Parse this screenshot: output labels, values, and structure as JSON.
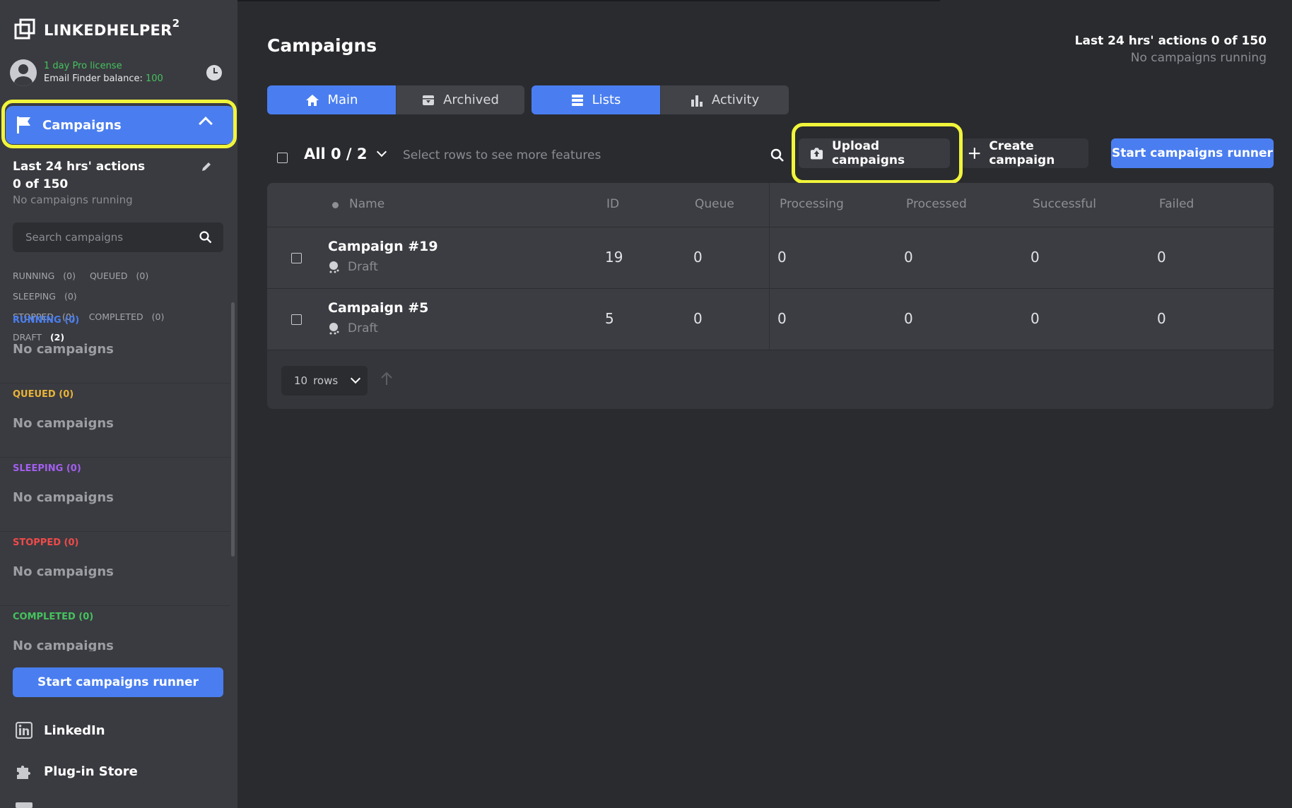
{
  "app": {
    "brand": "LINKEDHELPER",
    "brand_sup": "2",
    "license": "1 day Pro license",
    "email_balance_label": "Email Finder balance:",
    "email_balance_value": "100"
  },
  "sidebar": {
    "campaigns_label": "Campaigns",
    "actions_line1": "Last 24 hrs' actions",
    "actions_line2": "0 of 150",
    "running_text": "No campaigns running",
    "search_placeholder": "Search campaigns",
    "filters": [
      {
        "label": "RUNNING",
        "count": "(0)"
      },
      {
        "label": "QUEUED",
        "count": "(0)"
      },
      {
        "label": "SLEEPING",
        "count": "(0)"
      },
      {
        "label": "STOPPED",
        "count": "(0)"
      },
      {
        "label": "COMPLETED",
        "count": "(0)"
      },
      {
        "label": "DRAFT",
        "count": "(2)"
      }
    ],
    "groups": [
      {
        "label": "RUNNING",
        "count": "(0)",
        "color": "#4a7ef0",
        "empty": "No campaigns"
      },
      {
        "label": "QUEUED",
        "count": "(0)",
        "color": "#e8b339",
        "empty": "No campaigns"
      },
      {
        "label": "SLEEPING",
        "count": "(0)",
        "color": "#a35ff0",
        "empty": "No campaigns"
      },
      {
        "label": "STOPPED",
        "count": "(0)",
        "color": "#ef4a4a",
        "empty": "No campaigns"
      },
      {
        "label": "COMPLETED",
        "count": "(0)",
        "color": "#45c25f",
        "empty": "No campaigns"
      }
    ],
    "start_runner": "Start campaigns runner",
    "bottom_nav": [
      "LinkedIn",
      "Plug-in Store"
    ]
  },
  "header": {
    "title": "Campaigns",
    "actions": "Last 24 hrs' actions 0 of 150",
    "running": "No campaigns running"
  },
  "tabs": {
    "left": [
      {
        "label": "Main",
        "icon": "home-icon",
        "active": true
      },
      {
        "label": "Archived",
        "icon": "archive-icon",
        "active": false
      }
    ],
    "right": [
      {
        "label": "Lists",
        "icon": "list-icon",
        "active": true
      },
      {
        "label": "Activity",
        "icon": "bar-chart-icon",
        "active": false
      }
    ]
  },
  "toolbar": {
    "all_label": "All 0 / 2",
    "hint": "Select rows to see more features",
    "upload": "Upload campaigns",
    "create": "Create campaign",
    "start": "Start campaigns runner"
  },
  "table": {
    "columns": [
      "Name",
      "ID",
      "Queue",
      "Processing",
      "Processed",
      "Successful",
      "Failed"
    ],
    "rows": [
      {
        "name": "Campaign #19",
        "status": "Draft",
        "id": "19",
        "queue": "0",
        "processing": "0",
        "processed": "0",
        "successful": "0",
        "failed": "0"
      },
      {
        "name": "Campaign #5",
        "status": "Draft",
        "id": "5",
        "queue": "0",
        "processing": "0",
        "processed": "0",
        "successful": "0",
        "failed": "0"
      }
    ],
    "rows_per_page": "10",
    "rows_label": "rows"
  },
  "colors": {
    "accent": "#4a7ef0",
    "highlight": "#f1f53a",
    "success": "#45c25f"
  }
}
